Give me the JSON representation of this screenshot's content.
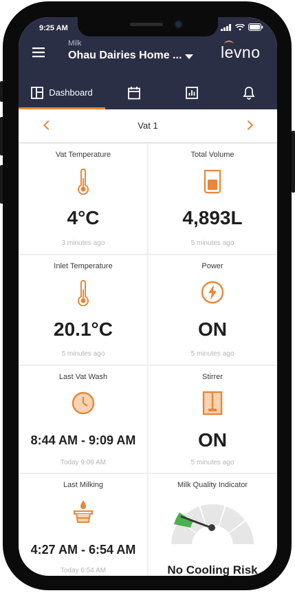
{
  "status_bar": {
    "time": "9:25 AM"
  },
  "header": {
    "subtitle": "Milk",
    "title": "Ohau Dairies Home ...",
    "logo": "levno"
  },
  "tabs": [
    {
      "label": "Dashboard",
      "icon": "dashboard-icon",
      "active": true
    },
    {
      "icon": "calendar-icon"
    },
    {
      "icon": "chart-icon"
    },
    {
      "icon": "bell-icon"
    }
  ],
  "vat_selector": {
    "title": "Vat 1"
  },
  "cards": {
    "vat_temperature": {
      "label": "Vat Temperature",
      "value": "4°C",
      "time": "3 minutes ago"
    },
    "total_volume": {
      "label": "Total Volume",
      "value": "4,893L",
      "time": "5 minutes ago"
    },
    "inlet_temperature": {
      "label": "Inlet Temperature",
      "value": "20.1°C",
      "time": "5 minutes ago"
    },
    "power": {
      "label": "Power",
      "value": "ON",
      "time": "5 minutes ago"
    },
    "last_vat_wash": {
      "label": "Last Vat Wash",
      "value": "8:44 AM - 9:09 AM",
      "time": "Today 9:09 AM"
    },
    "stirrer": {
      "label": "Stirrer",
      "value": "ON",
      "time": "5 minutes ago"
    },
    "last_milking": {
      "label": "Last Milking",
      "value": "4:27 AM - 6:54 AM",
      "time": "Today 6:54 AM"
    },
    "milk_quality": {
      "label": "Milk Quality Indicator",
      "value": "No Cooling Risk"
    }
  },
  "colors": {
    "accent": "#e8873a",
    "header_bg": "#2b2f45",
    "gauge_green": "#4caf50"
  }
}
